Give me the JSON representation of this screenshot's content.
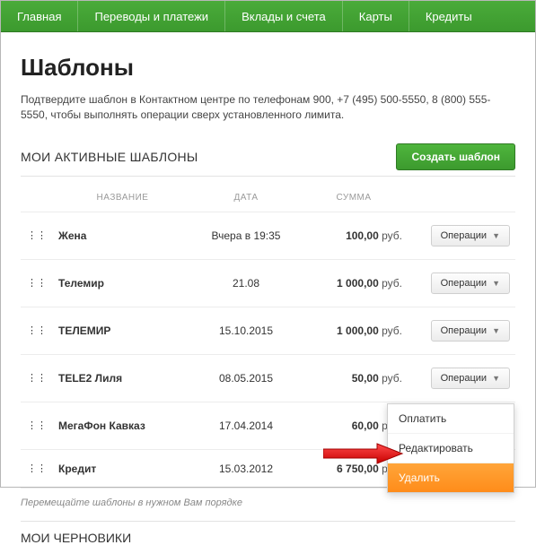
{
  "nav": {
    "items": [
      {
        "label": "Главная"
      },
      {
        "label": "Переводы и платежи"
      },
      {
        "label": "Вклады и счета"
      },
      {
        "label": "Карты"
      },
      {
        "label": "Кредиты"
      }
    ]
  },
  "page": {
    "title": "Шаблоны",
    "subtitle": "Подтвердите шаблон в Контактном центре по телефонам 900, +7 (495) 500-5550, 8 (800) 555-5550, чтобы выполнять операции сверх установленного лимита."
  },
  "active": {
    "section_title": "МОИ АКТИВНЫЕ ШАБЛОНЫ",
    "create_label": "Создать шаблон",
    "columns": {
      "name": "НАЗВАНИЕ",
      "date": "ДАТА",
      "sum": "СУММА"
    },
    "op_label": "Операции",
    "currency": "руб.",
    "rows": [
      {
        "name": "Жена",
        "date": "Вчера в 19:35",
        "sum": "100,00"
      },
      {
        "name": "Телемир",
        "date": "21.08",
        "sum": "1 000,00"
      },
      {
        "name": "ТЕЛЕМИР",
        "date": "15.10.2015",
        "sum": "1 000,00"
      },
      {
        "name": "TELE2 Лиля",
        "date": "08.05.2015",
        "sum": "50,00"
      },
      {
        "name": "МегаФон Кавказ",
        "date": "17.04.2014",
        "sum": "60,00"
      },
      {
        "name": "Кредит",
        "date": "15.03.2012",
        "sum": "6 750,00"
      }
    ]
  },
  "hint": "Перемещайте шаблоны в нужном Вам порядке",
  "drafts": {
    "section_title": "МОИ ЧЕРНОВИКИ"
  },
  "menu": {
    "pay": "Оплатить",
    "edit": "Редактировать",
    "delete": "Удалить"
  }
}
